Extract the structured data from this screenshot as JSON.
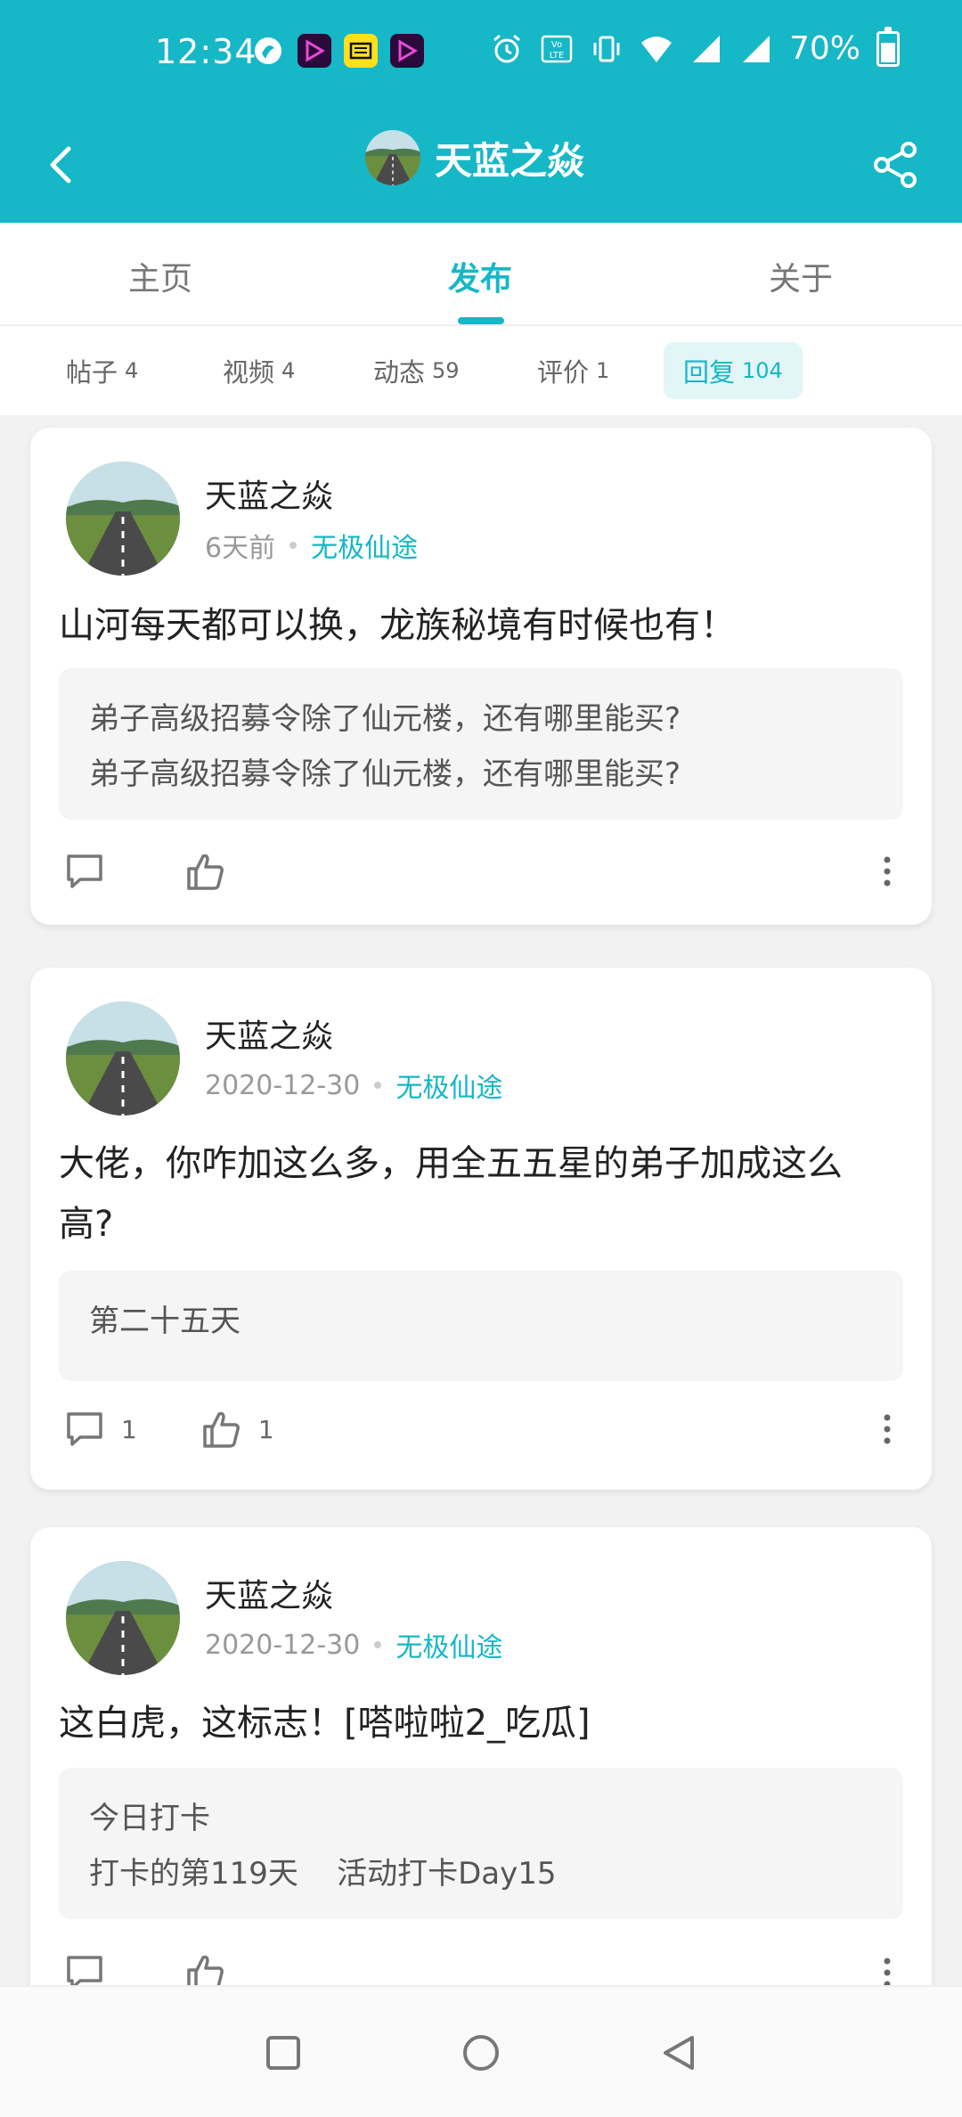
{
  "status": {
    "time": "12:34",
    "battery": "70%"
  },
  "header": {
    "title": "天蓝之焱"
  },
  "tabs": [
    {
      "label": "主页"
    },
    {
      "label": "发布"
    },
    {
      "label": "关于"
    }
  ],
  "subtabs": [
    {
      "label": "帖子",
      "count": "4"
    },
    {
      "label": "视频",
      "count": "4"
    },
    {
      "label": "动态",
      "count": "59"
    },
    {
      "label": "评价",
      "count": "1"
    },
    {
      "label": "回复",
      "count": "104"
    }
  ],
  "posts": [
    {
      "author": "天蓝之焱",
      "time": "6天前",
      "game": "无极仙途",
      "text": "山河每天都可以换，龙族秘境有时候也有！",
      "quote": "弟子高级招募令除了仙元楼，还有哪里能买?\n弟子高级招募令除了仙元楼，还有哪里能买?",
      "comments": "",
      "likes": ""
    },
    {
      "author": "天蓝之焱",
      "time": "2020-12-30",
      "game": "无极仙途",
      "text": "大佬，你咋加这么多，用全五五星的弟子加成这么高?",
      "quote": "第二十五天",
      "comments": "1",
      "likes": "1"
    },
    {
      "author": "天蓝之焱",
      "time": "2020-12-30",
      "game": "无极仙途",
      "text": "这白虎，这标志！[嗒啦啦2_吃瓜]",
      "quote": "今日打卡\n打卡的第119天    活动打卡Day15",
      "comments": "",
      "likes": ""
    }
  ],
  "colors": {
    "accent": "#16b7c6",
    "background": "#f2f2f2"
  }
}
